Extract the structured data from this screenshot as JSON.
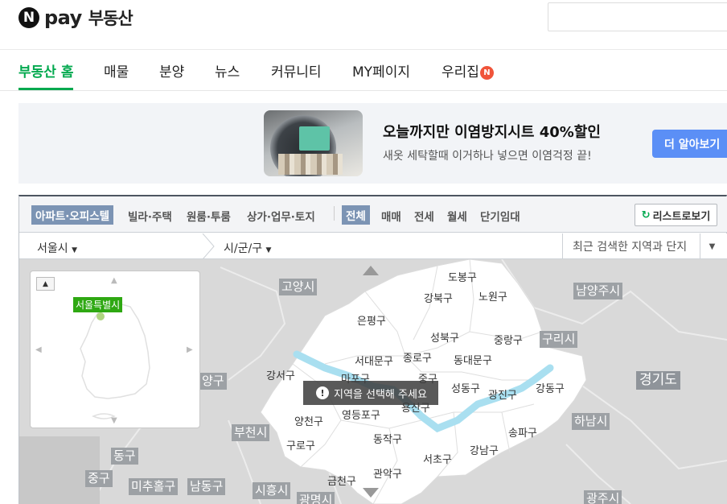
{
  "header": {
    "logo_n": "N",
    "logo_pay": "pay",
    "logo_service": "부동산"
  },
  "nav": {
    "items": [
      "부동산 홈",
      "매물",
      "분양",
      "뉴스",
      "커뮤니티",
      "MY페이지",
      "우리집"
    ],
    "badge": "N",
    "active_index": 0,
    "accent_color": "#03a94f"
  },
  "banner": {
    "title": "오늘까지만 이염방지시트 40%할인",
    "subtitle": "새옷 세탁할때 이거하나 넣으면 이염걱정 끝!",
    "button_label": "더 알아보기"
  },
  "filters": {
    "property_types": [
      "아파트·오피스텔",
      "빌라·주택",
      "원룸·투룸",
      "상가·업무·토지"
    ],
    "selected_property_type": "아파트·오피스텔",
    "trade_types": [
      "전체",
      "매매",
      "전세",
      "월세",
      "단기임대"
    ],
    "selected_trade_type": "전체",
    "list_button_label": "리스트로보기"
  },
  "region": {
    "city": "서울시",
    "district_placeholder": "시/군/구",
    "recent_placeholder": "최근 검색한 지역과 단지"
  },
  "map": {
    "notice": "지역을 선택해 주세요",
    "minimap_selected": "서울특별시",
    "districts": [
      "도봉구",
      "강북구",
      "노원구",
      "은평구",
      "성북구",
      "중랑구",
      "서대문구",
      "종로구",
      "동대문구",
      "강서구",
      "마포구",
      "중구",
      "성동구",
      "광진구",
      "강동구",
      "용산구",
      "영등포구",
      "양천구",
      "구로구",
      "동작구",
      "서초구",
      "강남구",
      "송파구",
      "관악구",
      "금천구"
    ],
    "outer_regions": [
      "고양시",
      "남양주시",
      "구리시",
      "경기도",
      "하남시",
      "부천시",
      "시흥시",
      "광명시",
      "광주시",
      "양구",
      "동구",
      "중구",
      "미추홀구",
      "남동구"
    ]
  }
}
